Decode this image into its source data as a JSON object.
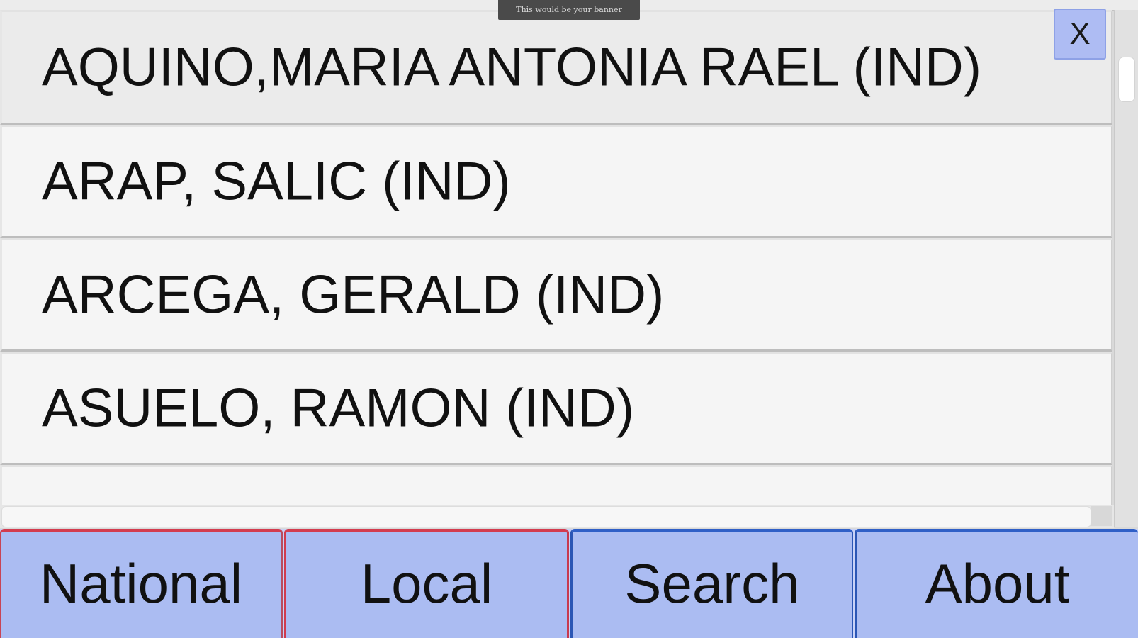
{
  "banner": {
    "text": "This would be your banner"
  },
  "close_button": {
    "label": "X"
  },
  "list": {
    "items": [
      {
        "label": "AQUINO,MARIA ANTONIA RAEL (IND)"
      },
      {
        "label": "ARAP, SALIC (IND)"
      },
      {
        "label": "ARCEGA, GERALD (IND)"
      },
      {
        "label": "ASUELO, RAMON (IND)"
      },
      {
        "label": ""
      }
    ]
  },
  "tabs": [
    {
      "label": "National",
      "accent": "#d33c4f"
    },
    {
      "label": "Local",
      "accent": "#d33c4f"
    },
    {
      "label": "Search",
      "accent": "#2f5fc7"
    },
    {
      "label": "About",
      "accent": "#2f5fc7"
    }
  ],
  "colors": {
    "tab_background": "#abbcf2",
    "list_item_background": "#f5f5f5",
    "text": "#111111"
  }
}
